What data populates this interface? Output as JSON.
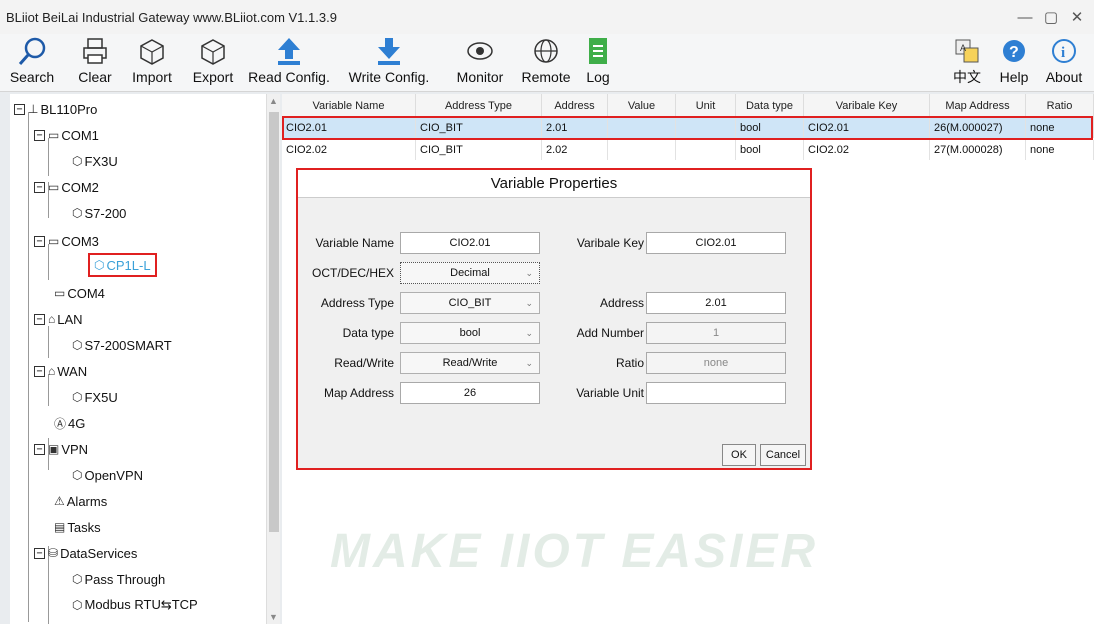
{
  "window": {
    "title": "BLiiot BeiLai Industrial Gateway www.BLiiot.com V1.1.3.9",
    "minimize": "—",
    "maximize": "▢",
    "close": "✕"
  },
  "toolbar": {
    "search": "Search",
    "clear": "Clear",
    "import": "Import",
    "export": "Export",
    "read_config": "Read Config.",
    "write_config": "Write Config.",
    "monitor": "Monitor",
    "remote": "Remote",
    "log": "Log",
    "language": "中文",
    "help": "Help",
    "about": "About"
  },
  "tree": {
    "root": "BL110Pro",
    "com1": "COM1",
    "fx3u": "FX3U",
    "com2": "COM2",
    "s7200": "S7-200",
    "com3": "COM3",
    "cp1ll": "CP1L-L",
    "com4": "COM4",
    "lan": "LAN",
    "s7200smart": "S7-200SMART",
    "wan": "WAN",
    "fx5u": "FX5U",
    "g4": "4G",
    "vpn": "VPN",
    "openvpn": "OpenVPN",
    "alarms": "Alarms",
    "tasks": "Tasks",
    "dataservices": "DataServices",
    "passthrough": "Pass Through",
    "modbus": "Modbus RTU⇆TCP"
  },
  "table": {
    "headers": [
      "Variable Name",
      "Address Type",
      "Address",
      "Value",
      "Unit",
      "Data type",
      "Varibale Key",
      "Map Address",
      "Ratio"
    ],
    "rows": [
      [
        "CIO2.01",
        "CIO_BIT",
        "2.01",
        "",
        "",
        "bool",
        "CIO2.01",
        "26(M.000027)",
        "none"
      ],
      [
        "CIO2.02",
        "CIO_BIT",
        "2.02",
        "",
        "",
        "bool",
        "CIO2.02",
        "27(M.000028)",
        "none"
      ]
    ]
  },
  "watermark": "MAKE IIOT EASIER",
  "dialog": {
    "title": "Variable Properties",
    "variable_name_label": "Variable Name",
    "variable_name": "CIO2.01",
    "variable_key_label": "Varibale Key",
    "variable_key": "CIO2.01",
    "radix_label": "OCT/DEC/HEX",
    "radix": "Decimal",
    "address_type_label": "Address Type",
    "address_type": "CIO_BIT",
    "address_label": "Address",
    "address": "2.01",
    "data_type_label": "Data type",
    "data_type": "bool",
    "add_number_label": "Add Number",
    "add_number": "1",
    "rw_label": "Read/Write",
    "rw": "Read/Write",
    "ratio_label": "Ratio",
    "ratio": "none",
    "map_address_label": "Map Address",
    "map_address": "26",
    "variable_unit_label": "Variable Unit",
    "variable_unit": "",
    "ok": "OK",
    "cancel": "Cancel"
  }
}
